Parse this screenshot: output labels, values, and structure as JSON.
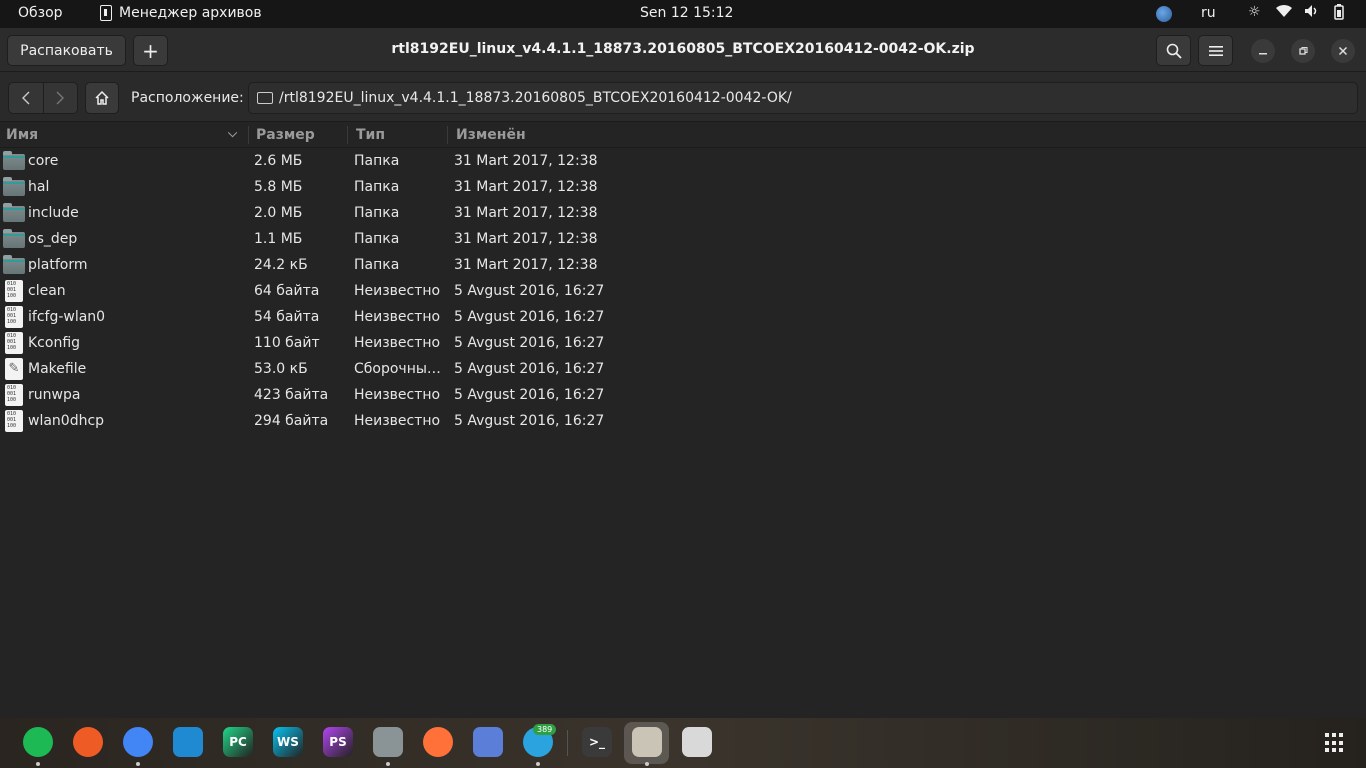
{
  "topbar": {
    "overview": "Обзор",
    "app_name": "Менеджер архивов",
    "clock": "Sen 12  15:12",
    "lang": "ru"
  },
  "window": {
    "title": "rtl8192EU_linux_v4.4.1.1_18873.20160805_BTCOEX20160412-0042-OK.zip",
    "extract_label": "Распаковать",
    "add_label": "+",
    "location_label": "Расположение:",
    "location_path": "/rtl8192EU_linux_v4.4.1.1_18873.20160805_BTCOEX20160412-0042-OK/"
  },
  "columns": {
    "name": "Имя",
    "size": "Размер",
    "type": "Тип",
    "modified": "Изменён"
  },
  "files": [
    {
      "name": "core",
      "size": "2.6 МБ",
      "type": "Папка",
      "modified": "31 Mart 2017, 12:38",
      "icon": "folder-icon"
    },
    {
      "name": "hal",
      "size": "5.8 МБ",
      "type": "Папка",
      "modified": "31 Mart 2017, 12:38",
      "icon": "folder-icon"
    },
    {
      "name": "include",
      "size": "2.0 МБ",
      "type": "Папка",
      "modified": "31 Mart 2017, 12:38",
      "icon": "folder-icon"
    },
    {
      "name": "os_dep",
      "size": "1.1 МБ",
      "type": "Папка",
      "modified": "31 Mart 2017, 12:38",
      "icon": "folder-icon"
    },
    {
      "name": "platform",
      "size": "24.2 кБ",
      "type": "Папка",
      "modified": "31 Mart 2017, 12:38",
      "icon": "folder-icon"
    },
    {
      "name": "clean",
      "size": "64 байта",
      "type": "Неизвестно",
      "modified": "5 Avgust 2016, 16:27",
      "icon": "binary-file-icon"
    },
    {
      "name": "ifcfg-wlan0",
      "size": "54 байта",
      "type": "Неизвестно",
      "modified": "5 Avgust 2016, 16:27",
      "icon": "binary-file-icon"
    },
    {
      "name": "Kconfig",
      "size": "110 байт",
      "type": "Неизвестно",
      "modified": "5 Avgust 2016, 16:27",
      "icon": "binary-file-icon"
    },
    {
      "name": "Makefile",
      "size": "53.0 кБ",
      "type": "Сборочный файл",
      "modified": "5 Avgust 2016, 16:27",
      "icon": "makefile-icon"
    },
    {
      "name": "runwpa",
      "size": "423 байта",
      "type": "Неизвестно",
      "modified": "5 Avgust 2016, 16:27",
      "icon": "binary-file-icon"
    },
    {
      "name": "wlan0dhcp",
      "size": "294 байта",
      "type": "Неизвестно",
      "modified": "5 Avgust 2016, 16:27",
      "icon": "binary-file-icon"
    }
  ],
  "dock": {
    "items": [
      {
        "name": "spotify-icon",
        "color": "#1db954",
        "glyph": "",
        "running": true
      },
      {
        "name": "postman-icon",
        "color": "#ef5b25",
        "glyph": "",
        "running": false
      },
      {
        "name": "chrome-icon",
        "color": "#4285f4",
        "glyph": "",
        "running": true
      },
      {
        "name": "vscode-icon",
        "color": "#1f8ad2",
        "glyph": "",
        "running": false
      },
      {
        "name": "pycharm-icon",
        "color": "#21d789",
        "glyph": "PC",
        "running": false
      },
      {
        "name": "webstorm-icon",
        "color": "#07c3f2",
        "glyph": "WS",
        "running": false
      },
      {
        "name": "phpstorm-icon",
        "color": "#b345f1",
        "glyph": "PS",
        "running": false
      },
      {
        "name": "files-icon",
        "color": "#8a9396",
        "glyph": "",
        "running": true
      },
      {
        "name": "firefox-icon",
        "color": "#ff7139",
        "glyph": "",
        "running": false
      },
      {
        "name": "tasks-icon",
        "color": "#5b7fd8",
        "glyph": "",
        "running": false
      },
      {
        "name": "telegram-icon",
        "color": "#2aa3df",
        "glyph": "",
        "running": true
      },
      {
        "name": "terminal-icon",
        "color": "#3a3a3a",
        "glyph": ">_",
        "running": false
      },
      {
        "name": "archive-manager-icon",
        "color": "#c9c4b6",
        "glyph": "",
        "running": true
      },
      {
        "name": "trash-icon",
        "color": "#d9d9d9",
        "glyph": "",
        "running": false
      }
    ],
    "telegram_badge": "389"
  }
}
